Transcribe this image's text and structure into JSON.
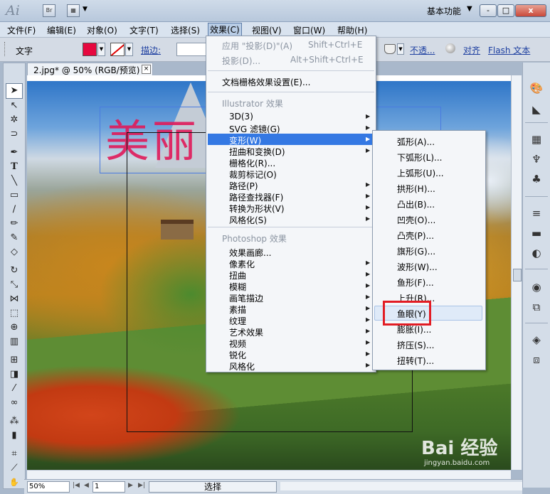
{
  "titlebar": {
    "app_logo": "Ai",
    "bridge": "Br",
    "workspace": "基本功能",
    "minimize": "-",
    "restore": "□",
    "close": "x"
  },
  "menubar": [
    "文件(F)",
    "编辑(E)",
    "对象(O)",
    "文字(T)",
    "选择(S)",
    "效果(C)",
    "视图(V)",
    "窗口(W)",
    "帮助(H)"
  ],
  "controlbar": {
    "tool_label": "文字",
    "stroke_label": "描边:",
    "opacity_label": "不透...",
    "align_label": "对齐",
    "flash_text_label": "Flash 文本",
    "fill_color": "#e6083f"
  },
  "document": {
    "tab_label": "2.jpg* @ 50% (RGB/预览)",
    "canvas_text": "美丽"
  },
  "effect_menu": {
    "apply_last": "应用 \"投影(D)\"(A)",
    "apply_last_shortcut": "Shift+Ctrl+E",
    "last_effect": "投影(D)...",
    "last_effect_shortcut": "Alt+Shift+Ctrl+E",
    "doc_raster_settings": "文档栅格效果设置(E)...",
    "illustrator_header": "Illustrator 效果",
    "illustrator_items": [
      "3D(3)",
      "SVG 滤镜(G)",
      "变形(W)",
      "扭曲和变换(D)",
      "栅格化(R)...",
      "裁剪标记(O)",
      "路径(P)",
      "路径查找器(F)",
      "转换为形状(V)",
      "风格化(S)"
    ],
    "photoshop_header": "Photoshop 效果",
    "photoshop_items": [
      "效果画廊...",
      "像素化",
      "扭曲",
      "模糊",
      "画笔描边",
      "素描",
      "纹理",
      "艺术效果",
      "视频",
      "锐化",
      "风格化"
    ]
  },
  "warp_submenu": [
    "弧形(A)...",
    "下弧形(L)...",
    "上弧形(U)...",
    "拱形(H)...",
    "凸出(B)...",
    "凹壳(O)...",
    "凸壳(P)...",
    "旗形(G)...",
    "波形(W)...",
    "鱼形(F)...",
    "上升(R)...",
    "鱼眼(Y)",
    "膨胀(I)...",
    "挤压(S)...",
    "扭转(T)..."
  ],
  "statusbar": {
    "zoom": "50%",
    "page": "1",
    "mode": "选择"
  },
  "watermark": {
    "logo": "Bai 经验",
    "url": "jingyan.baidu.com"
  }
}
